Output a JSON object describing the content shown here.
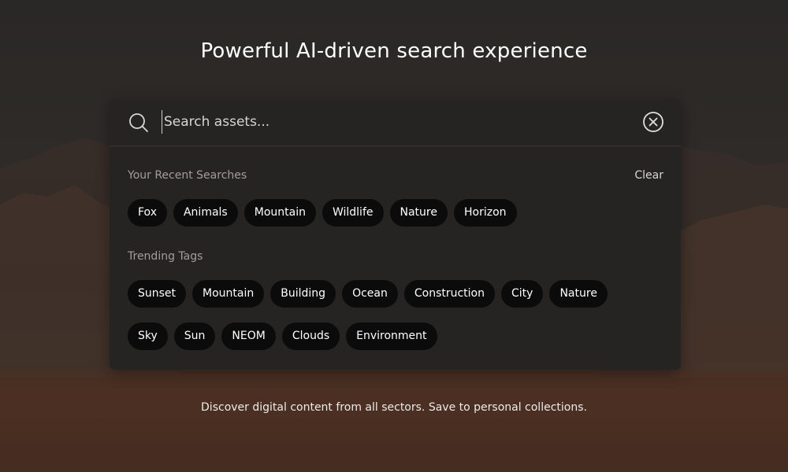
{
  "hero": {
    "headline": "Powerful AI-driven search experience",
    "footer": "Discover digital content from all sectors. Save to personal collections."
  },
  "search": {
    "placeholder": "Search assets...",
    "value": ""
  },
  "recent": {
    "label": "Your Recent Searches",
    "clear_label": "Clear",
    "items": [
      "Fox",
      "Animals",
      "Mountain",
      "Wildlife",
      "Nature",
      "Horizon"
    ]
  },
  "trending": {
    "label": "Trending Tags",
    "row1": [
      "Sunset",
      "Mountain",
      "Building",
      "Ocean",
      "Construction",
      "City",
      "Nature"
    ],
    "row2": [
      "Sky",
      "Sun",
      "NEOM",
      "Clouds",
      "Environment"
    ]
  },
  "icons": {
    "search": "search-icon",
    "clear": "close-circle-icon"
  },
  "colors": {
    "panel": "#262422",
    "chip": "#0b0b0b",
    "muted_text": "#a19e9b"
  }
}
